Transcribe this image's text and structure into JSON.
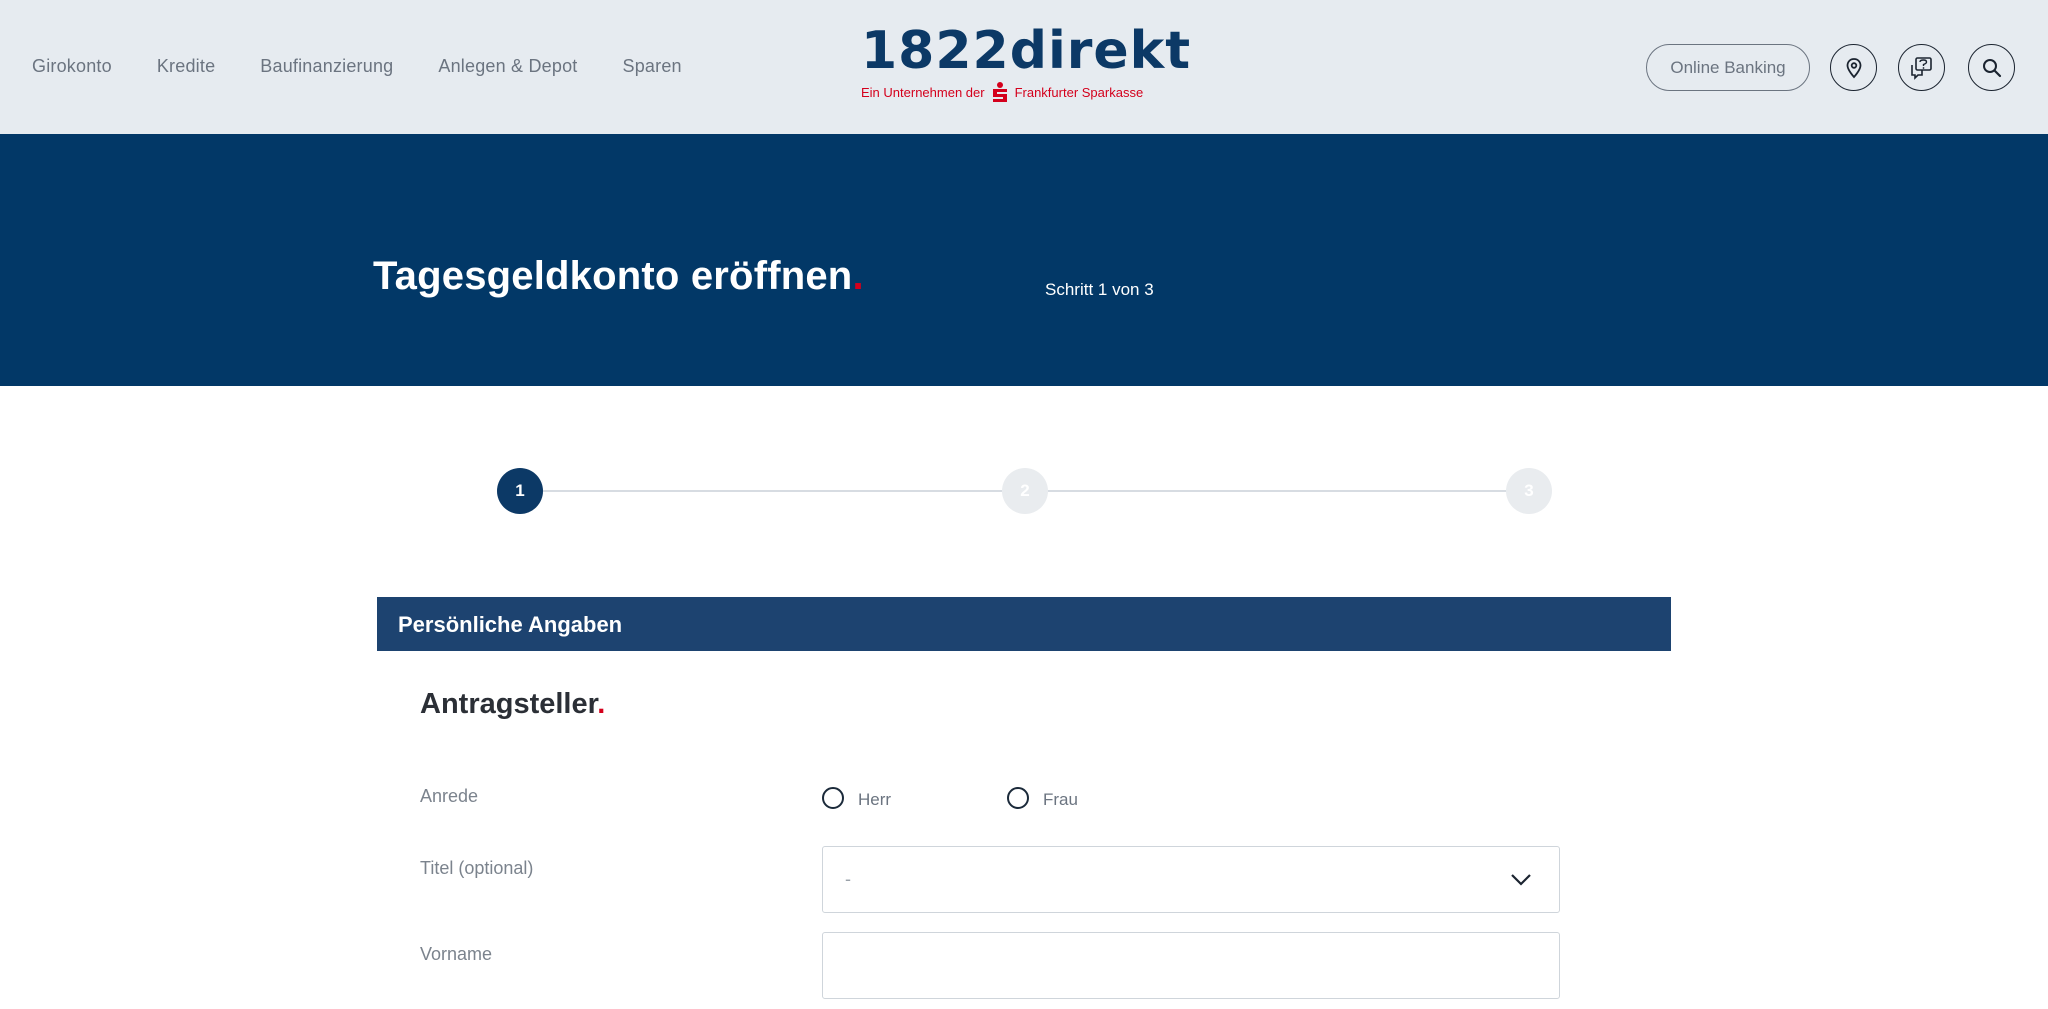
{
  "header": {
    "nav": [
      {
        "label": "Girokonto"
      },
      {
        "label": "Kredite"
      },
      {
        "label": "Baufinanzierung"
      },
      {
        "label": "Anlegen & Depot"
      },
      {
        "label": "Sparen"
      }
    ],
    "logo": {
      "word": "1822direkt",
      "tagline_left": "Ein Unternehmen der",
      "tagline_right": "Frankfurter Sparkasse"
    },
    "online_banking_label": "Online Banking",
    "icons": [
      "location-pin-icon",
      "help-chat-icon",
      "search-icon"
    ]
  },
  "hero": {
    "title": "Tagesgeldkonto eröffnen",
    "title_dot": ".",
    "step_text": "Schritt 1 von 3"
  },
  "stepper": {
    "steps": [
      {
        "number": "1",
        "state": "active"
      },
      {
        "number": "2",
        "state": "inactive"
      },
      {
        "number": "3",
        "state": "inactive"
      }
    ]
  },
  "form": {
    "section_title": "Persönliche Angaben",
    "subsection_title": "Antragsteller",
    "subsection_dot": ".",
    "fields": {
      "anrede": {
        "label": "Anrede",
        "options": [
          "Herr",
          "Frau"
        ]
      },
      "titel": {
        "label": "Titel (optional)",
        "value": "-"
      },
      "vorname": {
        "label": "Vorname",
        "value": ""
      }
    }
  },
  "colors": {
    "navy": "#023867",
    "section_bar": "#1d4370",
    "accent_red": "#d4001c",
    "header_bg": "#e6ebf0"
  }
}
